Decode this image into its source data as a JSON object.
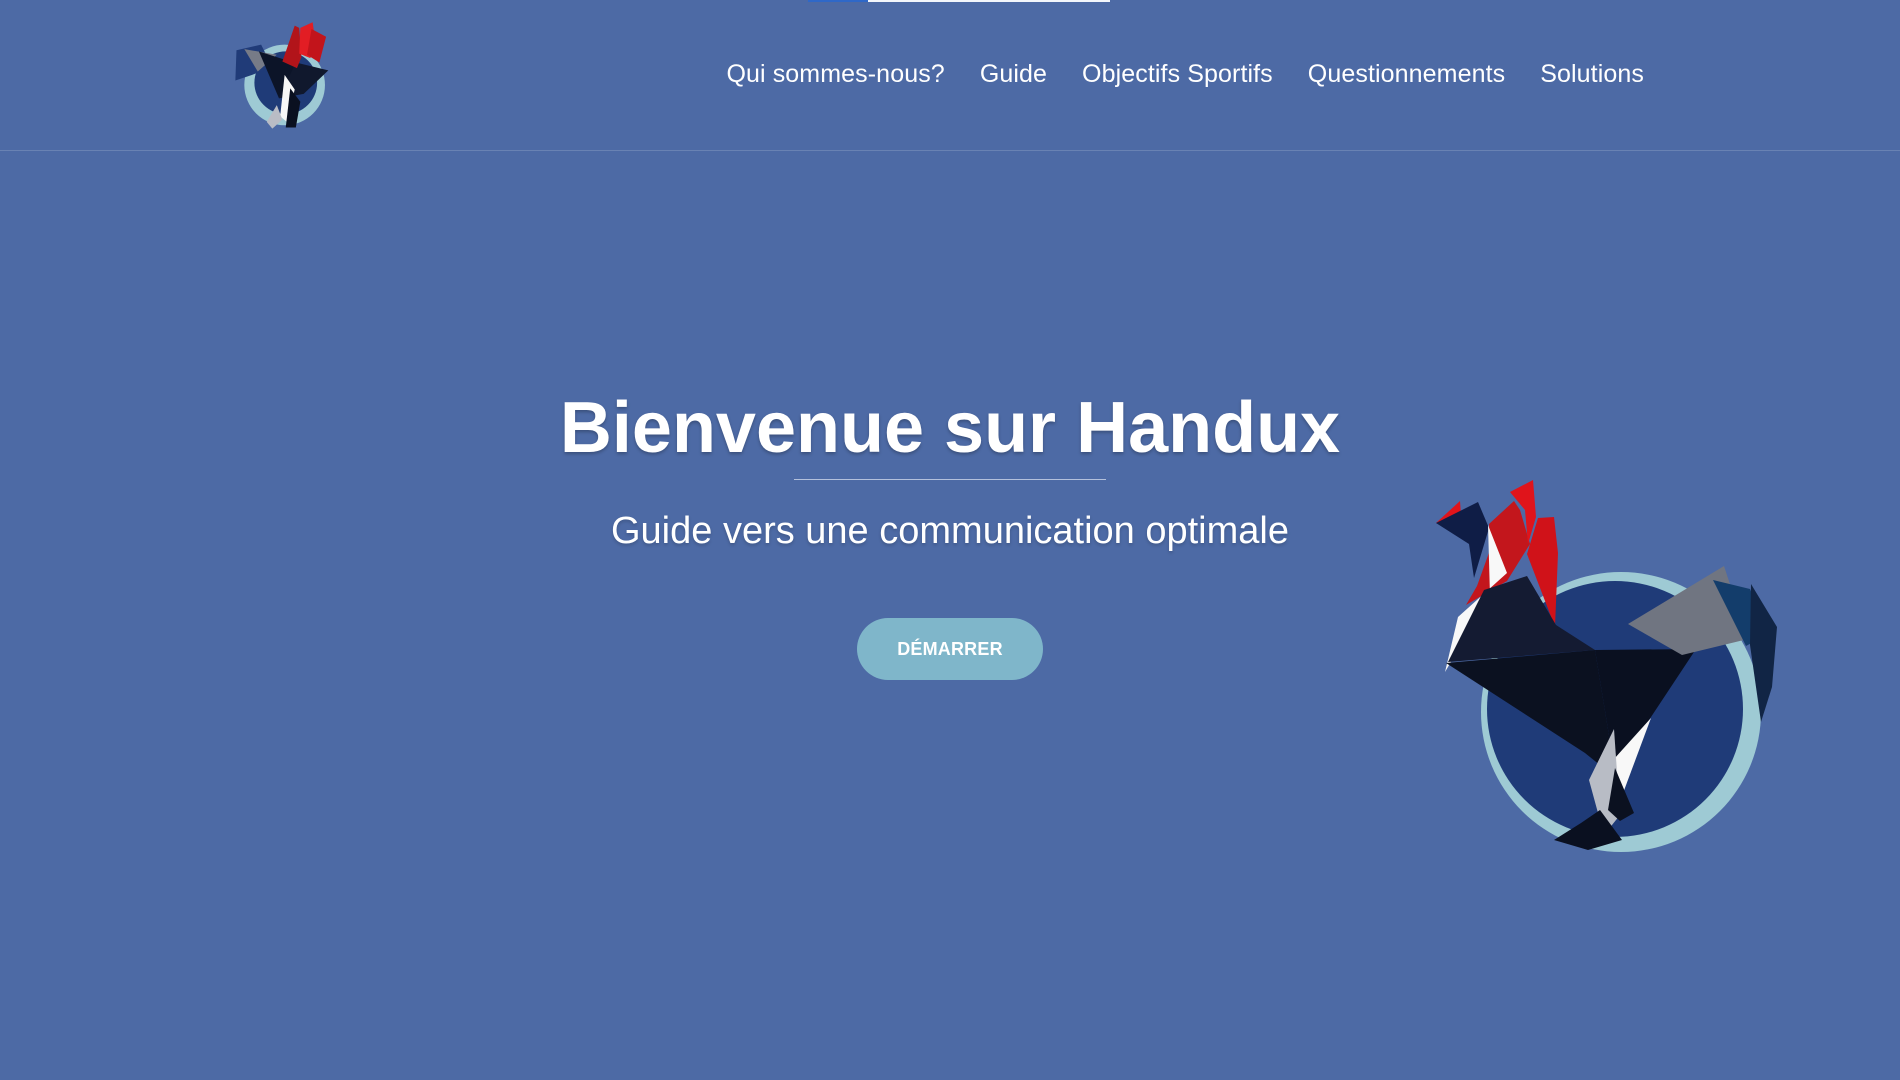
{
  "header": {
    "logo_icon": "rooster-logo-icon",
    "nav": [
      {
        "label": "Qui sommes-nous?"
      },
      {
        "label": "Guide"
      },
      {
        "label": "Objectifs Sportifs"
      },
      {
        "label": "Questionnements"
      },
      {
        "label": "Solutions"
      }
    ]
  },
  "hero": {
    "title": "Bienvenue sur Handux",
    "subtitle": "Guide vers une communication optimale",
    "button_label": "DÉMARRER",
    "illustration_icon": "rooster-illustration-icon"
  },
  "colors": {
    "background": "#4d6aa5",
    "button": "#7fb6ca",
    "rooster_red": "#e0141b",
    "rooster_navy": "#0d1630",
    "circle_light": "#9ecad4",
    "circle_dark": "#1f3b78"
  }
}
